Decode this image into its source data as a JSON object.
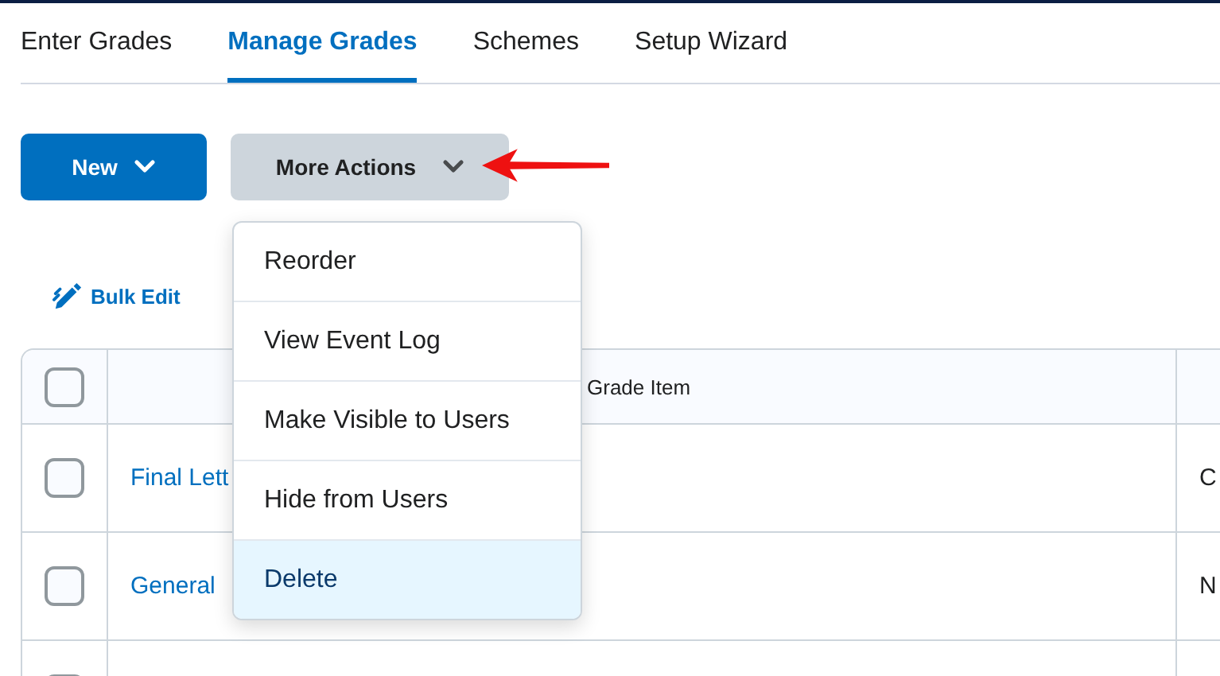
{
  "tabs": [
    {
      "label": "Enter Grades",
      "selected": false
    },
    {
      "label": "Manage Grades",
      "selected": true
    },
    {
      "label": "Schemes",
      "selected": false
    },
    {
      "label": "Setup Wizard",
      "selected": false
    }
  ],
  "new_button": {
    "label": "New"
  },
  "more_actions_button": {
    "label": "More Actions",
    "expanded": true
  },
  "menu": {
    "items": [
      {
        "label": "Reorder",
        "highlighted": false
      },
      {
        "label": "View Event Log",
        "highlighted": false
      },
      {
        "label": "Make Visible to Users",
        "highlighted": false
      },
      {
        "label": "Hide from Users",
        "highlighted": false
      },
      {
        "label": "Delete",
        "highlighted": true
      }
    ]
  },
  "bulk_edit": {
    "label": "Bulk Edit"
  },
  "table": {
    "header_checkbox": {
      "checked": false
    },
    "columns": [
      {
        "label": "Grade Item"
      }
    ],
    "rows": [
      {
        "checked": false,
        "name": "Final Lett",
        "column_3": "C"
      },
      {
        "checked": false,
        "name": "General",
        "column_3": "N"
      },
      {
        "checked": false
      }
    ]
  }
}
